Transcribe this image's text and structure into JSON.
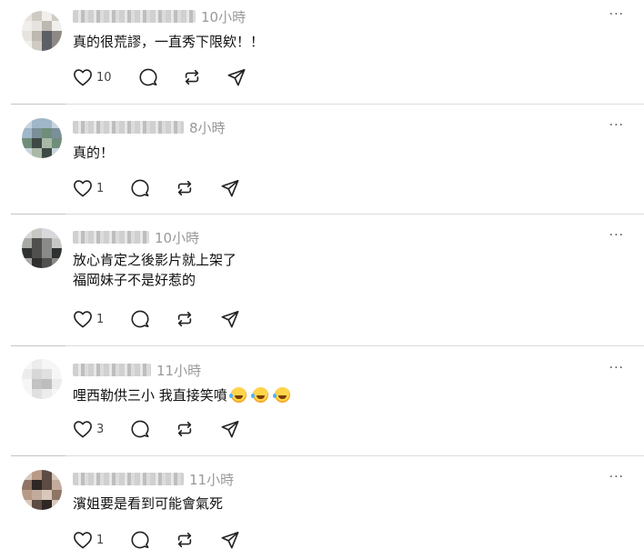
{
  "feed": {
    "more_glyph": "···",
    "posts": [
      {
        "username": "",
        "time": "10小時",
        "lines": [
          "真的很荒謬，一直秀下限欸！！"
        ],
        "emoji_count": 0,
        "like_count": "10",
        "avatar_colors": [
          "#e6e3de",
          "#cfcac2",
          "#f1efeb",
          "#5c5f66",
          "#bdb8b0",
          "#8d8a86"
        ]
      },
      {
        "username": "",
        "time": "8小時",
        "lines": [
          "真的！"
        ],
        "emoji_count": 0,
        "like_count": "1",
        "avatar_colors": [
          "#9fb7c8",
          "#6e8e7a",
          "#c8d4de",
          "#3f4a45",
          "#7b8f99",
          "#aab8a8"
        ]
      },
      {
        "username": "",
        "time": "10小時",
        "lines": [
          "放心肯定之後影片就上架了",
          "福岡妹子不是好惹的"
        ],
        "emoji_count": 0,
        "like_count": "1",
        "avatar_colors": [
          "#d8d8dc",
          "#50514f",
          "#a7a9a4",
          "#2f3130",
          "#8a8b88",
          "#c7c8c4"
        ]
      },
      {
        "username": "",
        "time": "11小時",
        "lines": [
          "哩西勒供三小 我直接笑噴"
        ],
        "emoji_count": 3,
        "like_count": "3",
        "avatar_colors": [
          "#ececec",
          "#d7d7d7",
          "#f6f6f6",
          "#c3c3c3",
          "#e0e0e0",
          "#bdbdbd"
        ]
      },
      {
        "username": "",
        "time": "11小時",
        "lines": [
          "濱姐要是看到可能會氣死"
        ],
        "emoji_count": 0,
        "like_count": "1",
        "avatar_colors": [
          "#b89a86",
          "#5d4c44",
          "#d8c7ba",
          "#2e2725",
          "#8f7566",
          "#c2ab9c"
        ]
      }
    ]
  }
}
